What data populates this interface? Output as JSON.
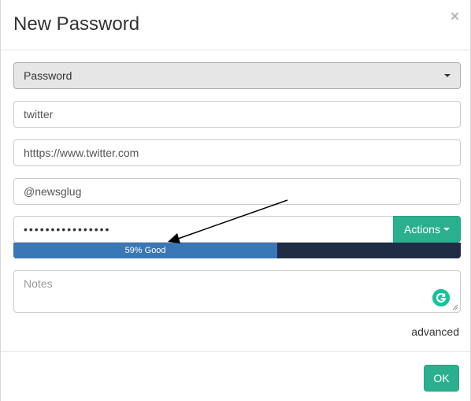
{
  "modal": {
    "title": "New Password",
    "close_label": "×"
  },
  "form": {
    "type_select": "Password",
    "title_value": "twitter",
    "url_value": "htttps://www.twitter.com",
    "username_value": "@newsglug",
    "password_masked": "••••••••••••••••",
    "actions_label": "Actions",
    "strength": {
      "percent": 59,
      "label": "59% Good"
    },
    "notes_placeholder": "Notes",
    "advanced_label": "advanced"
  },
  "footer": {
    "ok_label": "OK"
  },
  "colors": {
    "accent": "#2bb08f",
    "strength_fill": "#3a77b7",
    "strength_track": "#1f2d44"
  },
  "icons": {
    "close": "close-icon",
    "dropdown": "chevron-down-icon",
    "grammarly": "grammarly-icon",
    "resize": "resize-handle-icon"
  }
}
